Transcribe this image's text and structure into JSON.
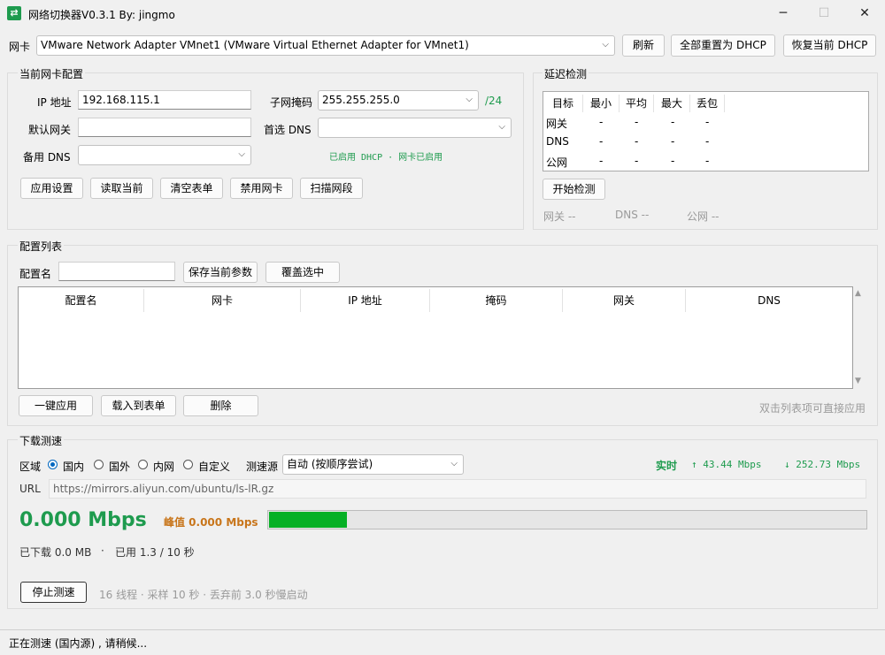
{
  "window": {
    "title": "网络切换器V0.3.1   By: jingmo",
    "app_icon_glyph": "⇄",
    "minimize": "─",
    "maximize": "☐",
    "close": "✕"
  },
  "adapter_bar": {
    "label": "网卡",
    "selected": "VMware Network Adapter VMnet1  (VMware Virtual Ethernet Adapter for VMnet1)",
    "refresh": "刷新",
    "reset_all_dhcp": "全部重置为 DHCP",
    "restore_dhcp": "恢复当前 DHCP"
  },
  "nic_config": {
    "title": "当前网卡配置",
    "ip_label": "IP 地址",
    "ip_value": "192.168.115.1",
    "mask_label": "子网掩码",
    "mask_value": "255.255.255.0",
    "prefix": "/24",
    "gateway_label": "默认网关",
    "gateway_value": "",
    "dns1_label": "首选 DNS",
    "dns1_value": "",
    "dns2_label": "备用 DNS",
    "dns2_value": "",
    "status_text": "已启用 DHCP  ·  网卡已启用",
    "buttons": {
      "apply": "应用设置",
      "read": "读取当前",
      "clear": "清空表单",
      "disable": "禁用网卡",
      "scan": "扫描网段"
    }
  },
  "latency": {
    "title": "延迟检测",
    "headers": [
      "目标",
      "最小",
      "平均",
      "最大",
      "丢包"
    ],
    "rows": [
      {
        "target": "网关",
        "min": "-",
        "avg": "-",
        "max": "-",
        "loss": "-"
      },
      {
        "target": "DNS",
        "min": "-",
        "avg": "-",
        "max": "-",
        "loss": "-"
      },
      {
        "target": "公网",
        "min": "-",
        "avg": "-",
        "max": "-",
        "loss": "-"
      }
    ],
    "start_button": "开始检测",
    "summary": {
      "gateway": "网关 --",
      "dns": "DNS --",
      "public": "公网 --"
    }
  },
  "profiles": {
    "title": "配置列表",
    "name_label": "配置名",
    "name_value": "",
    "save_button": "保存当前参数",
    "overwrite_button": "覆盖选中",
    "columns": [
      "配置名",
      "网卡",
      "IP 地址",
      "掩码",
      "网关",
      "DNS"
    ],
    "rows": [],
    "apply_button": "一键应用",
    "load_button": "载入到表单",
    "delete_button": "删除",
    "hint": "双击列表项可直接应用"
  },
  "speedtest": {
    "title": "下载测速",
    "region_label": "区域",
    "regions": [
      "国内",
      "国外",
      "内网",
      "自定义"
    ],
    "selected_region": "国内",
    "source_label": "测速源",
    "source_value": "自动 (按顺序尝试)",
    "realtime_label": "实时",
    "upload": "↑ 43.44 Mbps",
    "download": "↓ 252.73 Mbps",
    "url_label": "URL",
    "url_value": "https://mirrors.aliyun.com/ubuntu/ls-lR.gz",
    "current_speed": "0.000 Mbps",
    "peak": "峰值 0.000 Mbps",
    "progress_fraction": 0.13,
    "downloaded": "已下载 0.0 MB",
    "elapsed": "已用 1.3 / 10 秒",
    "stop_button": "停止测速",
    "params": "16 线程 · 采样 10 秒 · 丢弃前 3.0 秒慢启动",
    "colors": {
      "green": "#1e9b4e",
      "peak": "#c8751a",
      "bar": "#06b025"
    }
  },
  "status_bar": {
    "text": "正在测速 (国内源) , 请稍候..."
  }
}
